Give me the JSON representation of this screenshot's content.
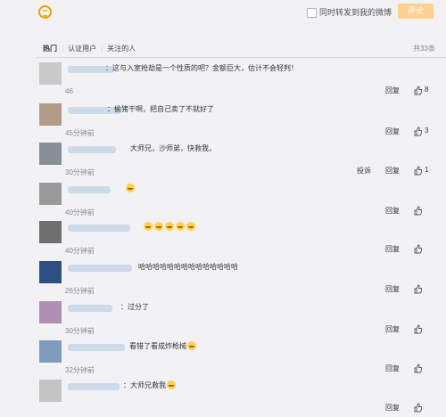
{
  "toolbar": {
    "emoji_icon": "smiley-icon",
    "repost_label": "同时转发到我的微博",
    "comment_button": "评论"
  },
  "tabs": [
    "热门",
    "认证用户",
    "关注的人"
  ],
  "total_count": "共33条",
  "comments": [
    {
      "text": "：这与入室抢劫是一个性质的吧？金额巨大，估计不会轻判！",
      "time": "46",
      "report": "",
      "reply": "回复",
      "likes": "8",
      "avatar_color": "#c9c9c9"
    },
    {
      "text": "：偷猪干啊，把自己卖了不就好了",
      "time": "45分钟前",
      "report": "",
      "reply": "回复",
      "likes": "3",
      "avatar_color": "#b29b88"
    },
    {
      "text": "大师兄，沙师弟，快救我，",
      "time": "30分钟前",
      "report": "投诉",
      "reply": "回复",
      "likes": "1",
      "avatar_color": "#8a8f97"
    },
    {
      "text": "",
      "emojis": 1,
      "time": "40分钟前",
      "report": "",
      "reply": "回复",
      "likes": "",
      "avatar_color": "#9a9a9a"
    },
    {
      "text": "",
      "emojis": 5,
      "time": "40分钟前",
      "report": "",
      "reply": "回复",
      "likes": "",
      "avatar_color": "#6f6f6f"
    },
    {
      "text": "哈哈哈哈哈哈哈哈哈哈哈哈哈哈",
      "time": "26分钟前",
      "report": "",
      "reply": "回复",
      "likes": "",
      "avatar_color": "#2d4f86"
    },
    {
      "text": "：过分了",
      "time": "30分钟前",
      "report": "",
      "reply": "回复",
      "likes": "",
      "avatar_color": "#b08fb5"
    },
    {
      "text": "看错了看成炸枪械",
      "emojis": 1,
      "time": "32分钟前",
      "report": "",
      "reply": "回复",
      "likes": "",
      "avatar_color": "#7f9cbf"
    },
    {
      "text": "：大师兄救我",
      "emojis": 1,
      "time": "",
      "report": "",
      "reply": "回复",
      "likes": "",
      "avatar_color": "#c4c4c4"
    }
  ]
}
